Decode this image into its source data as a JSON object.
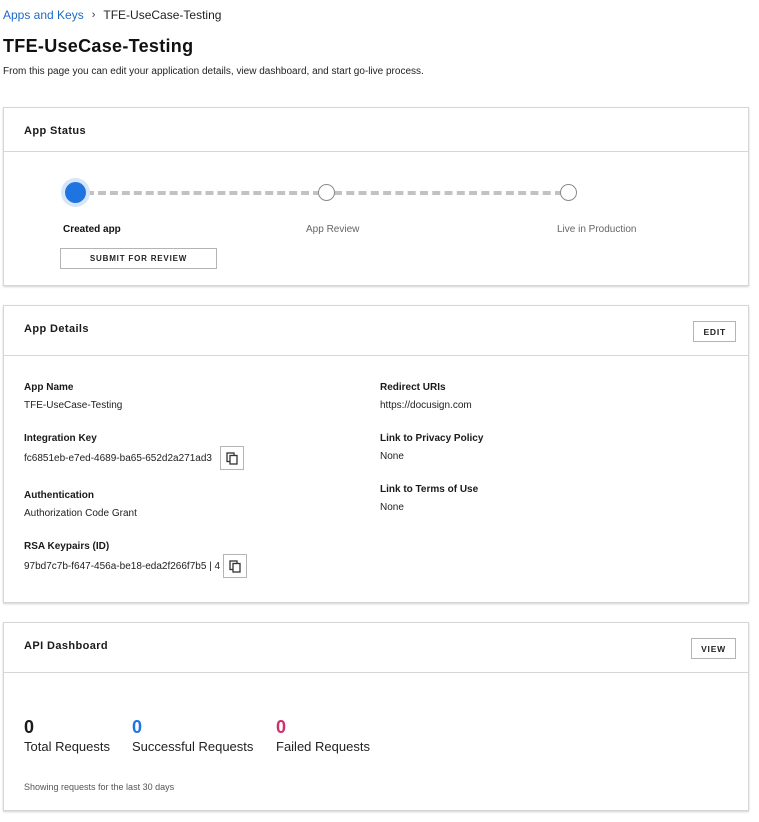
{
  "breadcrumb": {
    "parent": "Apps and Keys",
    "separator": "›",
    "current": "TFE-UseCase-Testing"
  },
  "page": {
    "title": "TFE-UseCase-Testing",
    "description": "From this page you can edit your application details, view dashboard, and start go-live process."
  },
  "status_card": {
    "title": "App Status",
    "steps": [
      {
        "label": "Created app",
        "state": "complete"
      },
      {
        "label": "App Review",
        "state": "pending"
      },
      {
        "label": "Live in Production",
        "state": "pending"
      }
    ],
    "submit_label": "SUBMIT FOR REVIEW"
  },
  "details_card": {
    "title": "App Details",
    "edit_label": "EDIT",
    "app_name": {
      "label": "App Name",
      "value": "TFE-UseCase-Testing"
    },
    "integration_key": {
      "label": "Integration Key",
      "value": "fc6851eb-e7ed-4689-ba65-652d2a271ad3"
    },
    "authentication": {
      "label": "Authentication",
      "value": "Authorization Code Grant"
    },
    "rsa_keypairs": {
      "label": "RSA Keypairs (ID)",
      "value": "97bd7c7b-f647-456a-be18-eda2f266f7b5 | 4"
    },
    "redirect_uris": {
      "label": "Redirect URIs",
      "value": "https://docusign.com"
    },
    "privacy_policy": {
      "label": "Link to Privacy Policy",
      "value": "None"
    },
    "terms_of_use": {
      "label": "Link to Terms of Use",
      "value": "None"
    },
    "copy_icon": "copy-icon"
  },
  "api_card": {
    "title": "API Dashboard",
    "view_label": "VIEW",
    "total": {
      "value": "0",
      "label": "Total Requests",
      "color": "#1a1a1a"
    },
    "successful": {
      "value": "0",
      "label": "Successful Requests",
      "color": "#1e74e0"
    },
    "failed": {
      "value": "0",
      "label": "Failed Requests",
      "color": "#d0306a"
    },
    "footnote": "Showing requests for the last 30 days"
  },
  "colors": {
    "link": "#1e6ac8",
    "step_active": "#1e74e0"
  }
}
